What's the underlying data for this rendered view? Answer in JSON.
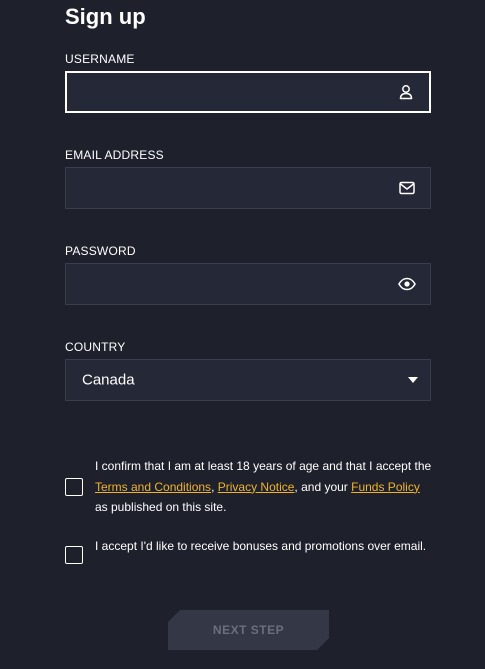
{
  "form": {
    "title": "Sign up",
    "username": {
      "label": "USERNAME",
      "value": "",
      "placeholder": ""
    },
    "email": {
      "label": "EMAIL ADDRESS",
      "value": "",
      "placeholder": ""
    },
    "password": {
      "label": "PASSWORD",
      "value": "",
      "placeholder": ""
    },
    "country": {
      "label": "COUNTRY",
      "selected": "Canada"
    }
  },
  "consent": {
    "age": {
      "text_1": "I confirm that I am at least 18 years of age and that I accept the ",
      "terms_link": "Terms and Conditions",
      "sep_1": ", ",
      "privacy_link": "Privacy Notice",
      "text_2": ", and your ",
      "funds_link": "Funds Policy",
      "text_3": " as published on this site.",
      "checked": false
    },
    "bonuses": {
      "text": "I accept I'd like to receive bonuses and promotions over email.",
      "checked": false
    }
  },
  "actions": {
    "next_label": "NEXT STEP"
  },
  "colors": {
    "background": "#1e202c",
    "field": "#252836",
    "link": "#f0b429",
    "button": "#343846"
  },
  "icons": {
    "username": "user-icon",
    "email": "mail-icon",
    "password": "eye-icon",
    "country": "caret-down-icon"
  }
}
